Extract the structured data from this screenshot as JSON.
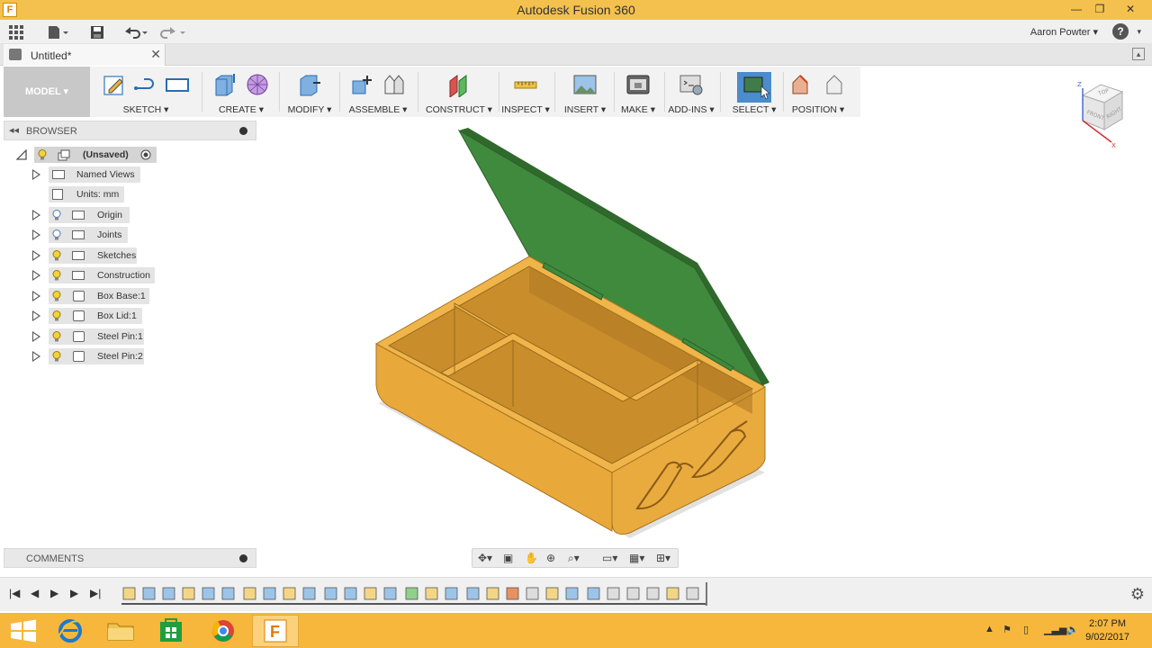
{
  "window": {
    "title": "Autodesk Fusion 360",
    "app_icon_letter": "F",
    "minimize": "—",
    "restore": "❐",
    "close": "✕"
  },
  "quick_access": {
    "user_name": "Aaron Powter",
    "help": "?"
  },
  "document_tab": {
    "label": "Untitled*",
    "close": "✕"
  },
  "toolbar": {
    "workspace": "MODEL ▾",
    "groups": [
      {
        "label": "SKETCH ▾"
      },
      {
        "label": "CREATE ▾"
      },
      {
        "label": "MODIFY ▾"
      },
      {
        "label": "ASSEMBLE ▾"
      },
      {
        "label": "CONSTRUCT ▾"
      },
      {
        "label": "INSPECT ▾"
      },
      {
        "label": "INSERT ▾"
      },
      {
        "label": "MAKE ▾"
      },
      {
        "label": "ADD-INS ▾"
      },
      {
        "label": "SELECT ▾"
      },
      {
        "label": "POSITION ▾"
      }
    ]
  },
  "viewcube": {
    "top": "TOP",
    "front": "FRONT",
    "right": "RIGHT",
    "z_axis": "Z",
    "x_axis": "X"
  },
  "browser": {
    "title": "BROWSER",
    "root": "(Unsaved)",
    "items": [
      {
        "label": "Named Views"
      },
      {
        "label": "Units: mm"
      },
      {
        "label": "Origin"
      },
      {
        "label": "Joints"
      },
      {
        "label": "Sketches"
      },
      {
        "label": "Construction"
      },
      {
        "label": "Box Base:1"
      },
      {
        "label": "Box Lid:1"
      },
      {
        "label": "Steel Pin:1"
      },
      {
        "label": "Steel Pin:2"
      }
    ]
  },
  "comments": {
    "title": "COMMENTS"
  },
  "model": {
    "base_color": "#e8a93a",
    "lid_color": "#3f8a3c"
  },
  "taskbar": {
    "time": "2:07 PM",
    "date": "9/02/2017"
  }
}
